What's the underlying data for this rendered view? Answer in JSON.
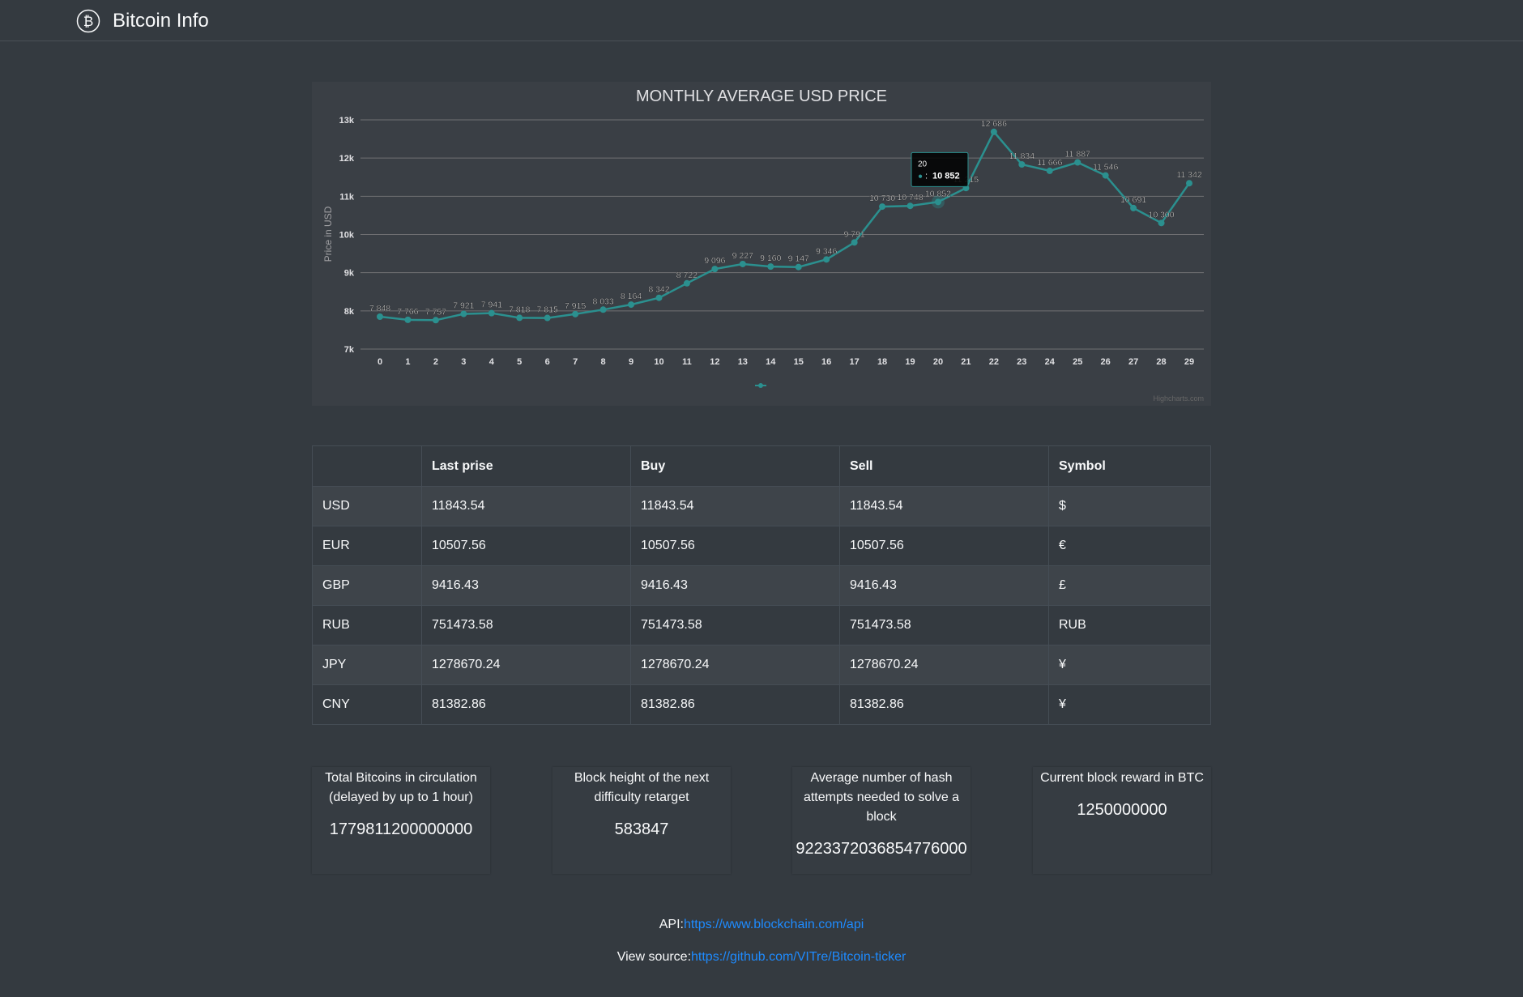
{
  "header": {
    "title": "Bitcoin Info",
    "logo_icon": "bitcoin-icon"
  },
  "chart_data": {
    "type": "line",
    "title": "MONTHLY AVERAGE USD PRICE",
    "ylabel": "Price in USD",
    "xlabel": "",
    "x": [
      0,
      1,
      2,
      3,
      4,
      5,
      6,
      7,
      8,
      9,
      10,
      11,
      12,
      13,
      14,
      15,
      16,
      17,
      18,
      19,
      20,
      21,
      22,
      23,
      24,
      25,
      26,
      27,
      28,
      29
    ],
    "values": [
      7848,
      7766,
      7757,
      7921,
      7941,
      7818,
      7815,
      7915,
      8033,
      8164,
      8342,
      8722,
      9096,
      9227,
      9160,
      9147,
      9346,
      9791,
      10730,
      10748,
      10852,
      11215,
      12686,
      11834,
      11666,
      11887,
      11546,
      10691,
      10300,
      11342
    ],
    "data_labels": [
      "7 848",
      "7 766",
      "7 757",
      "7 921",
      "7 941",
      "7 818",
      "7 815",
      "7 915",
      "8 033",
      "8 164",
      "8 342",
      "8 722",
      "9 096",
      "9 227",
      "9 160",
      "9 147",
      "9 346",
      "9 791",
      "10 730",
      "10 748",
      "10 852",
      "11 215",
      "12 686",
      "11 834",
      "11 666",
      "11 887",
      "11 546",
      "10 691",
      "10 300",
      "11 342"
    ],
    "ylim": [
      7000,
      13000
    ],
    "yticks": [
      7000,
      8000,
      9000,
      10000,
      11000,
      12000,
      13000
    ],
    "ytick_labels": [
      "7k",
      "8k",
      "9k",
      "10k",
      "11k",
      "12k",
      "13k"
    ],
    "grid": true,
    "legend": "bottom-center",
    "color": "#2b908f",
    "credits": "Highcharts.com",
    "tooltip": {
      "index": 20,
      "header": "20",
      "value": "10 852",
      "marker": "●",
      "separator": ": "
    }
  },
  "table": {
    "headers": [
      "",
      "Last prise",
      "Buy",
      "Sell",
      "Symbol"
    ],
    "rows": [
      [
        "USD",
        "11843.54",
        "11843.54",
        "11843.54",
        "$"
      ],
      [
        "EUR",
        "10507.56",
        "10507.56",
        "10507.56",
        "€"
      ],
      [
        "GBP",
        "9416.43",
        "9416.43",
        "9416.43",
        "£"
      ],
      [
        "RUB",
        "751473.58",
        "751473.58",
        "751473.58",
        "RUB"
      ],
      [
        "JPY",
        "1278670.24",
        "1278670.24",
        "1278670.24",
        "¥"
      ],
      [
        "CNY",
        "81382.86",
        "81382.86",
        "81382.86",
        "¥"
      ]
    ]
  },
  "stats": [
    {
      "label": "Total Bitcoins in circulation (delayed by up to 1 hour)",
      "value": "1779811200000000"
    },
    {
      "label": "Block height of the next difficulty retarget",
      "value": "583847"
    },
    {
      "label": "Average number of hash attempts needed to solve a block",
      "value": "9223372036854776000"
    },
    {
      "label": "Current block reward in BTC",
      "value": "1250000000"
    }
  ],
  "footer": {
    "api_label": "API:",
    "api_link": "https://www.blockchain.com/api",
    "source_label": "View source:",
    "source_link": "https://github.com/VITre/Bitcoin-ticker"
  }
}
